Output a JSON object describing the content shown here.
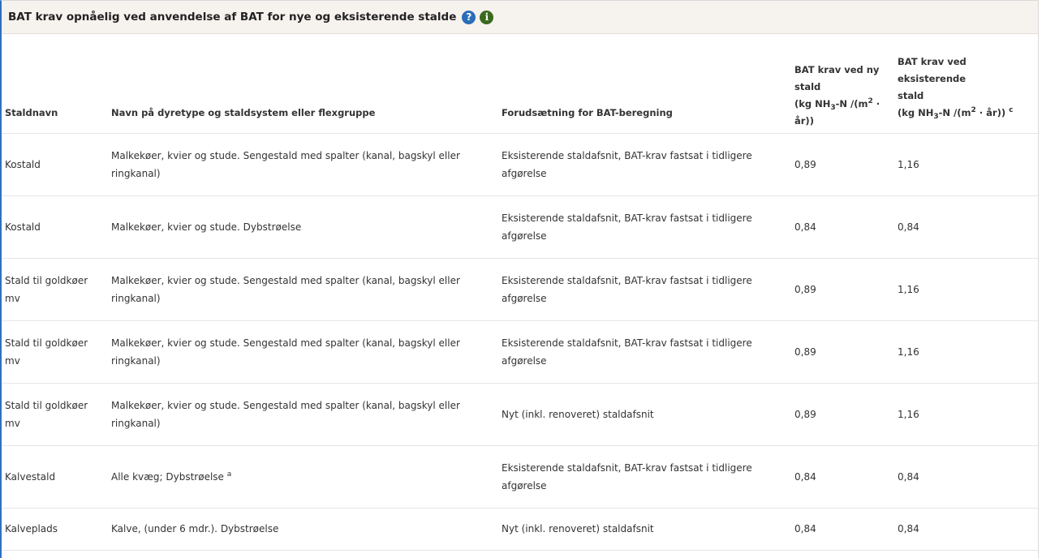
{
  "panel": {
    "title": "BAT krav opnåelig ved anvendelse af BAT for nye og eksisterende stalde",
    "help_icon": "?",
    "info_icon": "i"
  },
  "table": {
    "headers": {
      "staldnavn": "Staldnavn",
      "navn": "Navn på dyretype og staldsystem eller flexgruppe",
      "forudsaetning": "Forudsætning for BAT-beregning",
      "ny_line1": "BAT krav ved ny",
      "ny_line2": "stald",
      "ny_unit_a": "(kg NH",
      "ny_unit_sub": "3",
      "ny_unit_b": "-N /(m",
      "ny_unit_sup": "2",
      "ny_unit_c": " ·",
      "ny_unit_d": "år))",
      "eks_line1": "BAT krav ved eksisterende",
      "eks_line2": "stald",
      "eks_unit_a": "(kg NH",
      "eks_unit_sub": "3",
      "eks_unit_b": "-N /(m",
      "eks_unit_sup": "2",
      "eks_unit_c": " · år))",
      "eks_footnote": "c"
    },
    "rows": [
      {
        "staldnavn": "Kostald",
        "navn": "Malkekøer, kvier og stude. Sengestald med spalter (kanal, bagskyl eller ringkanal)",
        "navn_sup": "",
        "forudsaetning": "Eksisterende staldafsnit, BAT-krav fastsat i tidligere afgørelse",
        "ny": "0,89",
        "eks": "1,16"
      },
      {
        "staldnavn": "Kostald",
        "navn": "Malkekøer, kvier og stude. Dybstrøelse",
        "navn_sup": "",
        "forudsaetning": "Eksisterende staldafsnit, BAT-krav fastsat i tidligere afgørelse",
        "ny": "0,84",
        "eks": "0,84"
      },
      {
        "staldnavn": "Stald til goldkøer mv",
        "navn": "Malkekøer, kvier og stude. Sengestald med spalter (kanal, bagskyl eller ringkanal)",
        "navn_sup": "",
        "forudsaetning": "Eksisterende staldafsnit, BAT-krav fastsat i tidligere afgørelse",
        "ny": "0,89",
        "eks": "1,16"
      },
      {
        "staldnavn": "Stald til goldkøer mv",
        "navn": "Malkekøer, kvier og stude. Sengestald med spalter (kanal, bagskyl eller ringkanal)",
        "navn_sup": "",
        "forudsaetning": "Eksisterende staldafsnit, BAT-krav fastsat i tidligere afgørelse",
        "ny": "0,89",
        "eks": "1,16"
      },
      {
        "staldnavn": "Stald til goldkøer mv",
        "navn": "Malkekøer, kvier og stude. Sengestald med spalter (kanal, bagskyl eller ringkanal)",
        "navn_sup": "",
        "forudsaetning": "Nyt (inkl. renoveret) staldafsnit",
        "ny": "0,89",
        "eks": "1,16"
      },
      {
        "staldnavn": "Kalvestald",
        "navn": "Alle kvæg; Dybstrøelse",
        "navn_sup": "a",
        "forudsaetning": "Eksisterende staldafsnit, BAT-krav fastsat i tidligere afgørelse",
        "ny": "0,84",
        "eks": "0,84"
      },
      {
        "staldnavn": "Kalveplads",
        "navn": "Kalve, (under 6 mdr.). Dybstrøelse",
        "navn_sup": "",
        "forudsaetning": "Nyt (inkl. renoveret) staldafsnit",
        "ny": "0,84",
        "eks": "0,84"
      }
    ]
  }
}
